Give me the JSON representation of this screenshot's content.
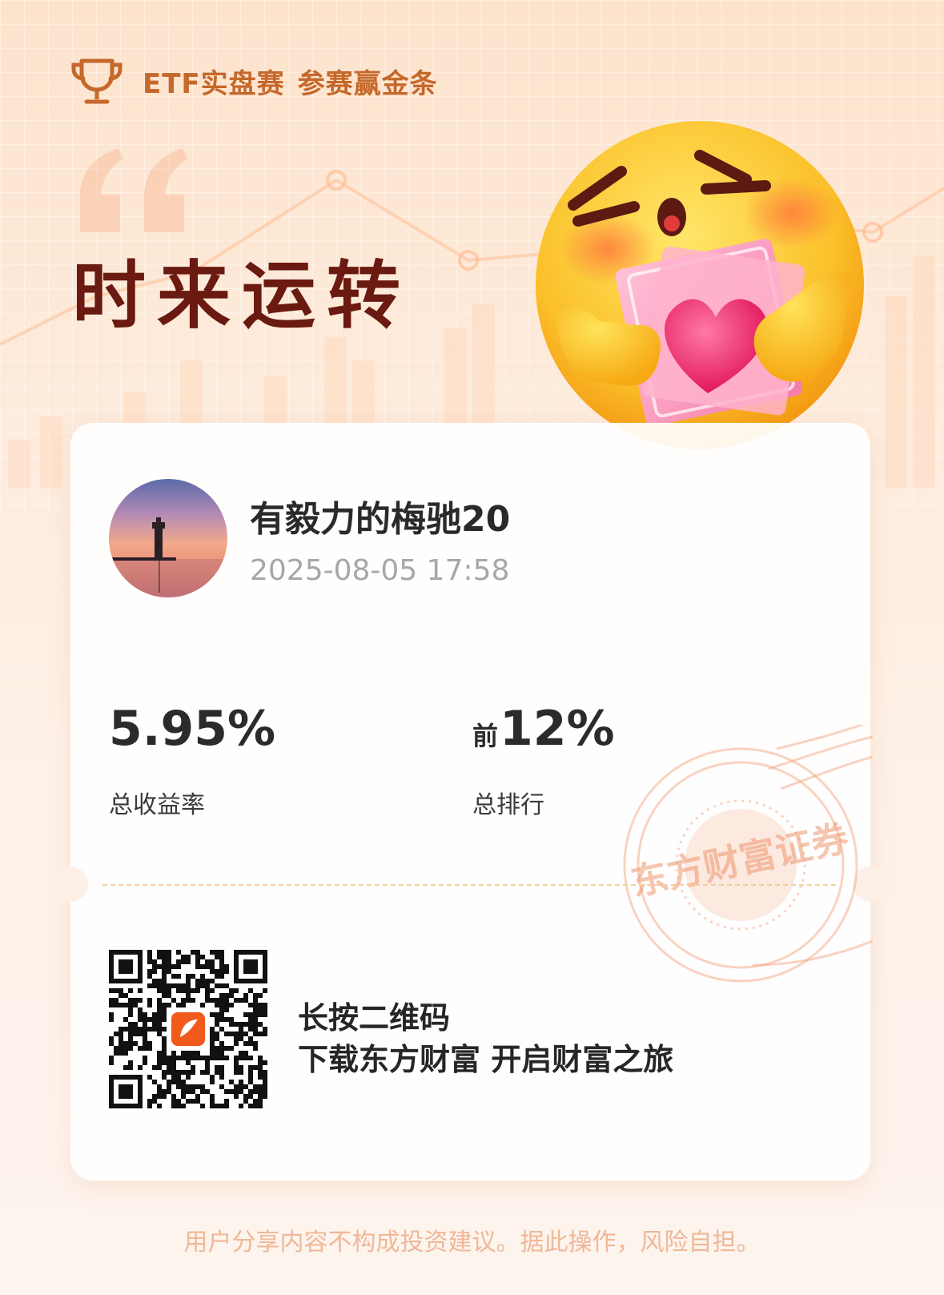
{
  "header": {
    "title": "ETF实盘赛",
    "subtitle": "参赛赢金条"
  },
  "slogan": "时来运转",
  "user": {
    "name": "有毅力的梅驰20",
    "datetime": "2025-08-05 17:58"
  },
  "stats": {
    "return": {
      "value": "5.95%",
      "label": "总收益率"
    },
    "rank": {
      "prefix": "前",
      "value": "12%",
      "label": "总排行"
    }
  },
  "stamp_text": "东方财富证券",
  "promo": {
    "line1": "长按二维码",
    "line2": "下载东方财富 开启财富之旅"
  },
  "disclaimer": "用户分享内容不构成投资建议。据此操作，风险自担。",
  "colors": {
    "accent": "#c5682b",
    "slogan": "#6a1a10",
    "stamp": "#f0a985",
    "card": "#ffffff"
  },
  "icons": {
    "trophy": "trophy-icon",
    "emoji": "money-hug-emoji",
    "app_logo": "eastmoney-logo-icon"
  }
}
